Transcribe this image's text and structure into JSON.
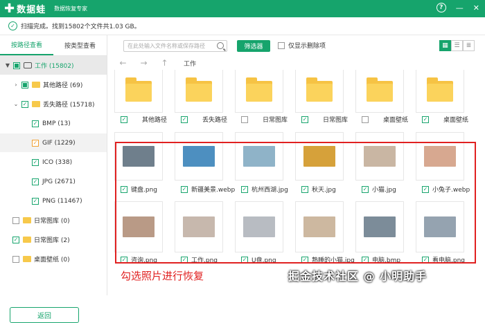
{
  "app": {
    "logo_symbol": "✚",
    "name": "数据蛙",
    "subtitle": "数据恢复专家",
    "brand_color": "#16a46c"
  },
  "window_controls": {
    "help": "?",
    "minimize": "—",
    "close": "✕"
  },
  "status": {
    "icon": "check",
    "text": "扫描完成。找到15802个文件共1.03 GB。"
  },
  "sidebar": {
    "tabs": [
      {
        "label": "按路径查看",
        "active": true
      },
      {
        "label": "按类型查看",
        "active": false
      }
    ],
    "tree": [
      {
        "label": "工作 (15802)",
        "arrow": "▼",
        "check": "part",
        "icon": "drive",
        "level": 0
      },
      {
        "label": "其他路径 (69)",
        "arrow": "›",
        "check": "part",
        "icon": "folder",
        "level": 1
      },
      {
        "label": "丢失路径 (15718)",
        "arrow": "⌄",
        "check": "on",
        "icon": "folder",
        "level": 1
      },
      {
        "label": "BMP (13)",
        "arrow": "",
        "check": "on",
        "icon": "",
        "level": 2
      },
      {
        "label": "GIF (1229)",
        "arrow": "",
        "check": "orange",
        "icon": "",
        "level": 2
      },
      {
        "label": "ICO (338)",
        "arrow": "",
        "check": "on",
        "icon": "",
        "level": 2
      },
      {
        "label": "JPG (2671)",
        "arrow": "",
        "check": "on",
        "icon": "",
        "level": 2
      },
      {
        "label": "PNG (11467)",
        "arrow": "",
        "check": "on",
        "icon": "",
        "level": 2
      },
      {
        "label": "日常图库 (0)",
        "arrow": "",
        "check": "off",
        "icon": "folder",
        "level": 1
      },
      {
        "label": "日常图库 (2)",
        "arrow": "",
        "check": "on",
        "icon": "folder",
        "level": 1
      },
      {
        "label": "桌面壁纸 (0)",
        "arrow": "",
        "check": "off",
        "icon": "folder",
        "level": 1
      }
    ],
    "back_label": "返回"
  },
  "toolbar": {
    "search_placeholder": "在此处输入文件名称或保存路径",
    "filter_label": "筛选器",
    "only_deleted_label": "仅显示删除项",
    "views": [
      "grid",
      "list",
      "detail"
    ]
  },
  "nav": {
    "back": "←",
    "forward": "→",
    "up": "↑",
    "path": "工作"
  },
  "files": [
    {
      "name": "其他路径",
      "type": "folder",
      "checked": true
    },
    {
      "name": "丢失路径",
      "type": "folder",
      "checked": true
    },
    {
      "name": "日常图库",
      "type": "folder",
      "checked": false
    },
    {
      "name": "日常图库",
      "type": "folder",
      "checked": true
    },
    {
      "name": "桌面壁纸",
      "type": "folder",
      "checked": false
    },
    {
      "name": "桌面壁纸",
      "type": "folder",
      "checked": true
    },
    {
      "name": "键盘.png",
      "type": "image",
      "checked": true,
      "color": "#6f7f8c"
    },
    {
      "name": "新疆美景.webp",
      "type": "image",
      "checked": true,
      "color": "#4d8fc0"
    },
    {
      "name": "杭州西湖.jpg",
      "type": "image",
      "checked": true,
      "color": "#8fb3c8"
    },
    {
      "name": "秋天.jpg",
      "type": "image",
      "checked": true,
      "color": "#d6a13a"
    },
    {
      "name": "小猫.jpg",
      "type": "image",
      "checked": true,
      "color": "#c9b6a3"
    },
    {
      "name": "小兔子.webp",
      "type": "image",
      "checked": true,
      "color": "#d7a890"
    },
    {
      "name": "咨询.png",
      "type": "image",
      "checked": true,
      "color": "#b99a86"
    },
    {
      "name": "工作.png",
      "type": "image",
      "checked": true,
      "color": "#c7b8ad"
    },
    {
      "name": "U盘.png",
      "type": "image",
      "checked": true,
      "color": "#b8bcc2"
    },
    {
      "name": "熟睡的小猫.jpg",
      "type": "image",
      "checked": true,
      "color": "#cdb8a0"
    },
    {
      "name": "电脑.bmp",
      "type": "image",
      "checked": true,
      "color": "#7c8c99"
    },
    {
      "name": "看电脑.png",
      "type": "image",
      "checked": true,
      "color": "#95a3b0"
    }
  ],
  "annotation": {
    "caption": "勾选照片进行恢复",
    "color": "#e02020"
  },
  "watermark": "掘金技术社区 @ 小明助手"
}
